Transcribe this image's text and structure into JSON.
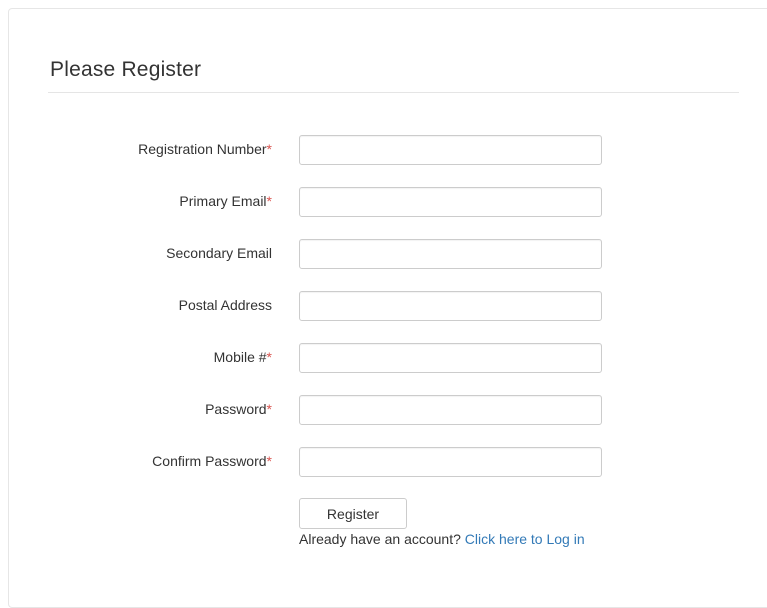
{
  "form": {
    "title": "Please Register",
    "required_mark": "*",
    "fields": [
      {
        "label": "Registration Number",
        "required": true,
        "value": "",
        "placeholder": ""
      },
      {
        "label": "Primary Email",
        "required": true,
        "value": "",
        "placeholder": ""
      },
      {
        "label": "Secondary Email",
        "required": false,
        "value": "",
        "placeholder": ""
      },
      {
        "label": "Postal Address",
        "required": false,
        "value": "",
        "placeholder": ""
      },
      {
        "label": "Mobile #",
        "required": true,
        "value": "",
        "placeholder": ""
      },
      {
        "label": "Password",
        "required": true,
        "value": "",
        "placeholder": ""
      },
      {
        "label": "Confirm Password",
        "required": true,
        "value": "",
        "placeholder": ""
      }
    ],
    "submit_label": "Register",
    "login_prompt": "Already have an account?",
    "login_link": "Click here to Log in"
  },
  "colors": {
    "required": "#d9534f",
    "link": "#337ab7"
  }
}
